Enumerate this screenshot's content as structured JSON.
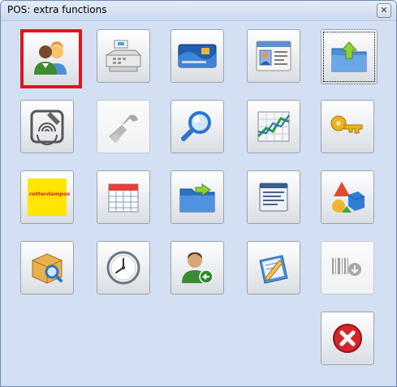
{
  "window": {
    "title": "POS: extra functions",
    "close_glyph": "✕"
  },
  "colors": {
    "client_bg": "#d3e0f3",
    "selection_border": "#e2141e",
    "logo_yellow": "#ffe500"
  },
  "buttons": [
    {
      "icon": "users-icon",
      "state": "selected"
    },
    {
      "icon": "cash-register-icon",
      "state": "normal"
    },
    {
      "icon": "payment-card-icon",
      "state": "normal"
    },
    {
      "icon": "contact-card-icon",
      "state": "normal"
    },
    {
      "icon": "folder-upload-icon",
      "state": "focused"
    },
    {
      "icon": "fingerprint-icon",
      "state": "normal"
    },
    {
      "icon": "wrench-icon",
      "state": "disabled"
    },
    {
      "icon": "magnifier-icon",
      "state": "normal"
    },
    {
      "icon": "line-chart-icon",
      "state": "normal"
    },
    {
      "icon": "key-icon",
      "state": "normal"
    },
    {
      "icon": "rotterdampos-logo-icon",
      "state": "normal",
      "logo_text": "rotterdampos"
    },
    {
      "icon": "calendar-icon",
      "state": "normal"
    },
    {
      "icon": "folder-export-icon",
      "state": "normal"
    },
    {
      "icon": "document-list-icon",
      "state": "normal"
    },
    {
      "icon": "shapes-icon",
      "state": "normal"
    },
    {
      "icon": "search-box-icon",
      "state": "normal"
    },
    {
      "icon": "clock-icon",
      "state": "normal"
    },
    {
      "icon": "user-logout-icon",
      "state": "normal"
    },
    {
      "icon": "edit-notes-icon",
      "state": "normal"
    },
    {
      "icon": "barcode-download-icon",
      "state": "disabled"
    },
    {
      "icon": "cancel-icon",
      "state": "normal"
    }
  ]
}
